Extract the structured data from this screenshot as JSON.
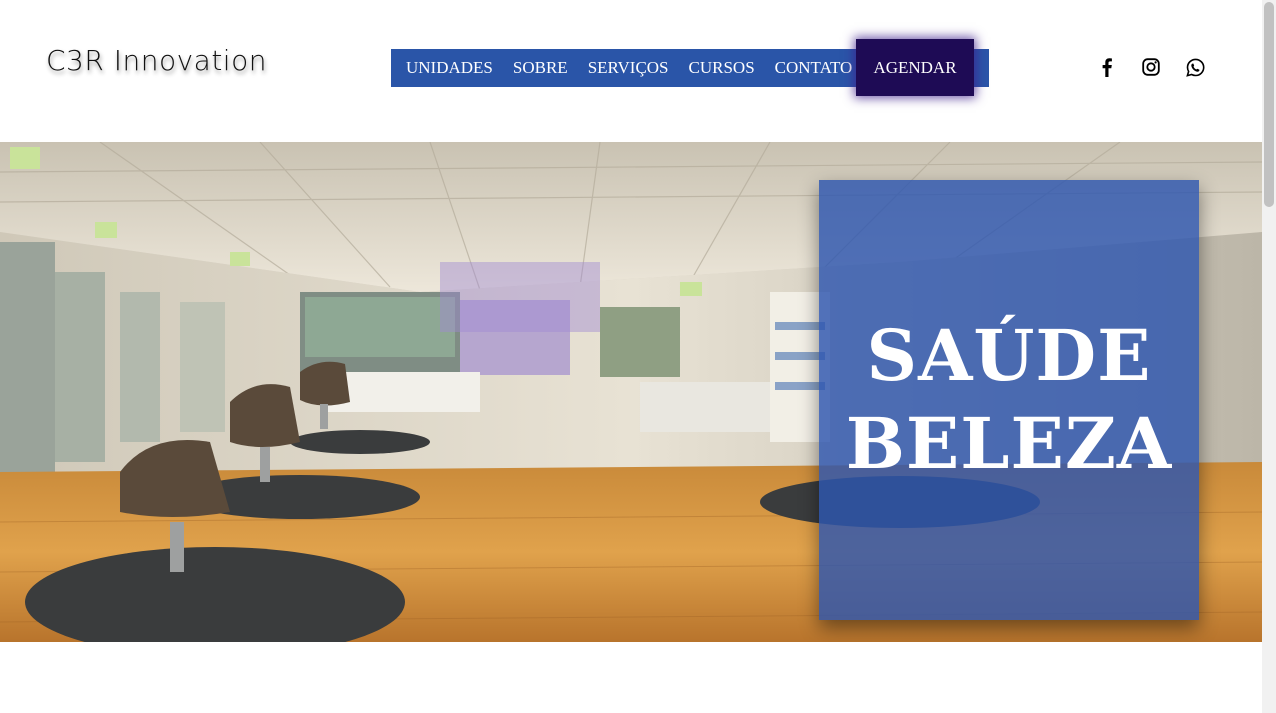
{
  "brand": {
    "name": "C3R Innovation"
  },
  "nav": {
    "items": [
      {
        "label": "UNIDADES"
      },
      {
        "label": "SOBRE"
      },
      {
        "label": "SERVIÇOS"
      },
      {
        "label": "CURSOS"
      },
      {
        "label": "CONTATO"
      }
    ],
    "cta_label": "AGENDAR"
  },
  "social": [
    {
      "icon": "facebook-icon"
    },
    {
      "icon": "instagram-icon"
    },
    {
      "icon": "whatsapp-icon"
    }
  ],
  "hero": {
    "line1": "SAÚDE",
    "line2": "BELEZA",
    "image": "salon-interior-photo"
  },
  "colors": {
    "nav_bg": "#2a55a8",
    "cta_bg": "#1e0b55",
    "overlay_bg": "#2d55af"
  }
}
